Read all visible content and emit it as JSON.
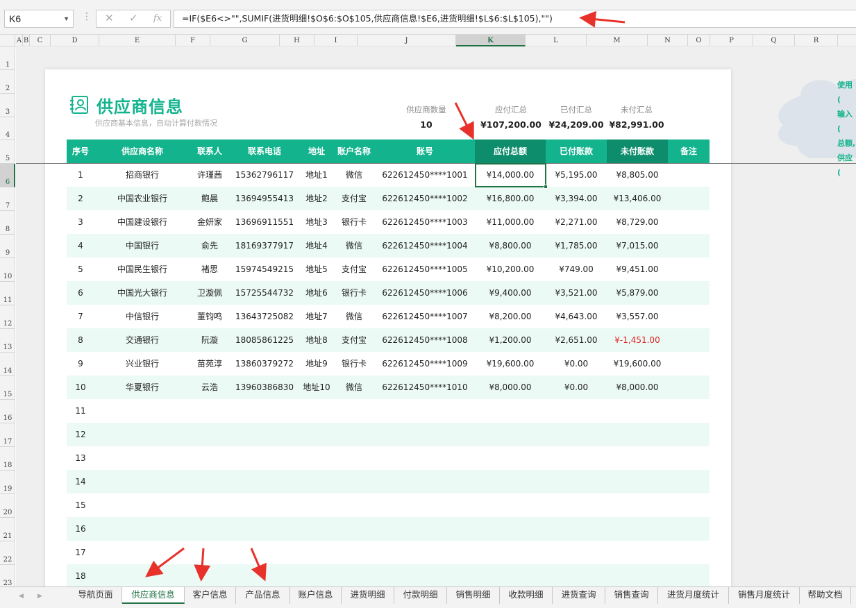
{
  "formula_bar": {
    "name_box": "K6",
    "cancel_glyph": "✕",
    "enter_glyph": "✓",
    "fx_glyph": "fx",
    "formula": "=IF($E6<>\"\",SUMIF(进货明细!$O$6:$O$105,供应商信息!$E6,进货明细!$L$6:$L$105),\"\")"
  },
  "columns": [
    "A",
    "B",
    "C",
    "D",
    "E",
    "F",
    "G",
    "H",
    "I",
    "J",
    "K",
    "L",
    "M",
    "N",
    "O",
    "P",
    "Q",
    "R"
  ],
  "selected_column": "K",
  "rows": [
    "1",
    "2",
    "3",
    "4",
    "5",
    "6",
    "7",
    "8",
    "9",
    "10",
    "11",
    "12",
    "13",
    "14",
    "15",
    "16",
    "17",
    "18",
    "19",
    "20",
    "21",
    "22",
    "23"
  ],
  "selected_row": "6",
  "header": {
    "title": "供应商信息",
    "subtitle": "供应商基本信息，自动计算付款情况"
  },
  "stats": [
    {
      "label": "供应商数量",
      "value": "10"
    },
    {
      "label": "应付汇总",
      "value": "¥107,200.00"
    },
    {
      "label": "已付汇总",
      "value": "¥24,209.00"
    },
    {
      "label": "未付汇总",
      "value": "¥82,991.00"
    }
  ],
  "table": {
    "headers": [
      "序号",
      "供应商名称",
      "联系人",
      "联系电话",
      "地址",
      "账户名称",
      "账号",
      "应付总额",
      "已付账款",
      "未付账款",
      "备注"
    ],
    "rows": [
      [
        "1",
        "招商银行",
        "许瑾茜",
        "15362796117",
        "地址1",
        "微信",
        "622612450****1001",
        "¥14,000.00",
        "¥5,195.00",
        "¥8,805.00",
        ""
      ],
      [
        "2",
        "中国农业银行",
        "鲍晨",
        "13694955413",
        "地址2",
        "支付宝",
        "622612450****1002",
        "¥16,800.00",
        "¥3,394.00",
        "¥13,406.00",
        ""
      ],
      [
        "3",
        "中国建设银行",
        "金妍家",
        "13696911551",
        "地址3",
        "银行卡",
        "622612450****1003",
        "¥11,000.00",
        "¥2,271.00",
        "¥8,729.00",
        ""
      ],
      [
        "4",
        "中国银行",
        "俞先",
        "18169377917",
        "地址4",
        "微信",
        "622612450****1004",
        "¥8,800.00",
        "¥1,785.00",
        "¥7,015.00",
        ""
      ],
      [
        "5",
        "中国民生银行",
        "褚思",
        "15974549215",
        "地址5",
        "支付宝",
        "622612450****1005",
        "¥10,200.00",
        "¥749.00",
        "¥9,451.00",
        ""
      ],
      [
        "6",
        "中国光大银行",
        "卫漩佩",
        "15725544732",
        "地址6",
        "银行卡",
        "622612450****1006",
        "¥9,400.00",
        "¥3,521.00",
        "¥5,879.00",
        ""
      ],
      [
        "7",
        "中信银行",
        "董钧鸣",
        "13643725082",
        "地址7",
        "微信",
        "622612450****1007",
        "¥8,200.00",
        "¥4,643.00",
        "¥3,557.00",
        ""
      ],
      [
        "8",
        "交通银行",
        "阮漩",
        "18085861225",
        "地址8",
        "支付宝",
        "622612450****1008",
        "¥1,200.00",
        "¥2,651.00",
        "¥-1,451.00",
        ""
      ],
      [
        "9",
        "兴业银行",
        "苗苑淳",
        "13860379272",
        "地址9",
        "银行卡",
        "622612450****1009",
        "¥19,600.00",
        "¥0.00",
        "¥19,600.00",
        ""
      ],
      [
        "10",
        "华夏银行",
        "云浩",
        "13960386830",
        "地址10",
        "微信",
        "622612450****1010",
        "¥8,000.00",
        "¥0.00",
        "¥8,000.00",
        ""
      ],
      [
        "11",
        "",
        "",
        "",
        "",
        "",
        "",
        "",
        "",
        "",
        ""
      ],
      [
        "12",
        "",
        "",
        "",
        "",
        "",
        "",
        "",
        "",
        "",
        ""
      ],
      [
        "13",
        "",
        "",
        "",
        "",
        "",
        "",
        "",
        "",
        "",
        ""
      ],
      [
        "14",
        "",
        "",
        "",
        "",
        "",
        "",
        "",
        "",
        "",
        ""
      ],
      [
        "15",
        "",
        "",
        "",
        "",
        "",
        "",
        "",
        "",
        "",
        ""
      ],
      [
        "16",
        "",
        "",
        "",
        "",
        "",
        "",
        "",
        "",
        "",
        ""
      ],
      [
        "17",
        "",
        "",
        "",
        "",
        "",
        "",
        "",
        "",
        "",
        ""
      ],
      [
        "18",
        "",
        "",
        "",
        "",
        "",
        "",
        "",
        "",
        "",
        ""
      ]
    ]
  },
  "cloud_note": [
    "使用(",
    "输入(",
    "总额,",
    "供应("
  ],
  "tabs": [
    "导航页面",
    "供应商信息",
    "客户信息",
    "产品信息",
    "账户信息",
    "进货明细",
    "付款明细",
    "销售明细",
    "收款明细",
    "进货查询",
    "销售查询",
    "进货月度统计",
    "销售月度统计",
    "帮助文档"
  ],
  "active_tab": "供应商信息",
  "colors": {
    "accent": "#12b38d",
    "accent_dark": "#0e8d6d",
    "row_alt": "#ecfaf6",
    "excel_green": "#217346",
    "negative": "#e02424",
    "annotation_arrow": "#e8312a"
  }
}
